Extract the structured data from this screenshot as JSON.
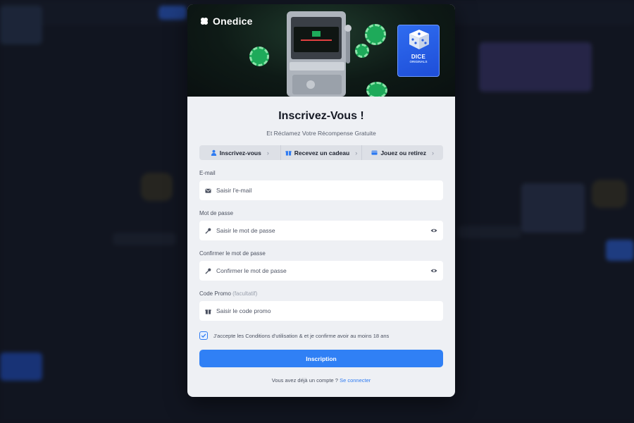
{
  "brand": {
    "name": "Onedice"
  },
  "banner": {
    "dice_title": "DICE",
    "dice_subtitle": "ORIGINALS"
  },
  "form": {
    "title": "Inscrivez-Vous !",
    "subtitle": "Et Réclamez Votre Récompense Gratuite",
    "steps": [
      {
        "label": "Inscrivez-vous",
        "icon": "user-icon"
      },
      {
        "label": "Recevez un cadeau",
        "icon": "gift-icon"
      },
      {
        "label": "Jouez ou retirez",
        "icon": "wallet-icon"
      }
    ],
    "email": {
      "label": "E-mail",
      "placeholder": "Saisir l'e-mail",
      "value": "",
      "icon": "mail-icon"
    },
    "password": {
      "label": "Mot de passe",
      "placeholder": "Saisir le mot de passe",
      "value": "",
      "icon": "key-icon"
    },
    "confirm_password": {
      "label": "Confirmer le mot de passe",
      "placeholder": "Confirmer le mot de passe",
      "value": "",
      "icon": "key-icon"
    },
    "promo": {
      "label": "Code Promo",
      "optional_note": "(facultatif)",
      "placeholder": "Saisir le code promo",
      "value": "",
      "icon": "gift-icon"
    },
    "terms": {
      "checked": true,
      "text": "J'accepte les Conditions d'utilisation & et je confirme avoir au moins 18 ans"
    },
    "submit_label": "Inscription",
    "login_prompt": "Vous avez déjà un compte ?",
    "login_link": "Se connecter"
  },
  "colors": {
    "accent": "#3080f5",
    "modal_bg": "#eef0f4",
    "banner_green": "#1eaa5a"
  }
}
